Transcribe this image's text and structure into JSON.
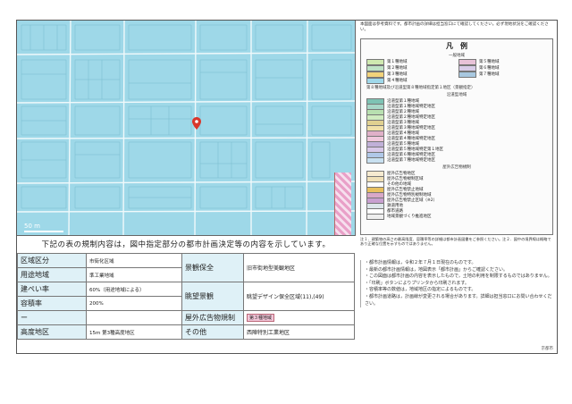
{
  "map": {
    "scale_label": "50 m",
    "pin_icon": "location-pin-icon"
  },
  "notes_top": "本図面は参考資料です。都市計画の詳細は担当窓口にて確認してください。必ず現地状況をご確認ください。",
  "legend": {
    "title": "凡　例",
    "section_zoning": "一般地域",
    "zoning_items": [
      {
        "label": "第１種地域",
        "color": "#cfe9b0"
      },
      {
        "label": "第５種地域",
        "color": "#e8c2d8"
      },
      {
        "label": "第２種地域",
        "color": "#bfe3c6"
      },
      {
        "label": "第６種地域",
        "color": "#d8cce8"
      },
      {
        "label": "第３種地域",
        "color": "#f2d37a"
      },
      {
        "label": "第７種地域",
        "color": "#a8c8e0"
      },
      {
        "label": "第４種地域",
        "color": "#9fd8ea"
      }
    ],
    "zoning_note": "第８種地域及び沿道型第８種地域指定第１地区（景観指定）",
    "section_roadside": "沿道型地域",
    "roadside_items": [
      {
        "label": "沿道型第１種地域",
        "color": "#7ec3b4"
      },
      {
        "label": "沿道型第１種地域特定地区",
        "color": "#a8d8c8"
      },
      {
        "label": "沿道型第２種地域",
        "color": "#b8e0b0"
      },
      {
        "label": "沿道型第２種地域特定地区",
        "color": "#d0ecc0"
      },
      {
        "label": "沿道型第３種地域",
        "color": "#e0d090"
      },
      {
        "label": "沿道型第３種地域特定地区",
        "color": "#f0e0a8"
      },
      {
        "label": "沿道型第４種地域",
        "color": "#e0b0c8"
      },
      {
        "label": "沿道型第４種地域特定地区",
        "color": "#f0c8dc"
      },
      {
        "label": "沿道型第５種地域",
        "color": "#c0b0d8"
      },
      {
        "label": "沿道型第５種地域特定第１地区",
        "color": "#d8c8e8"
      },
      {
        "label": "沿道型第６種地域特定地区",
        "color": "#b0c8e8"
      },
      {
        "label": "沿道型第７種地域特定地区",
        "color": "#c8e0f0"
      }
    ],
    "section_district": "屋外広告物規制",
    "district_items": [
      {
        "label": "屋外広告物地区",
        "color": "#f6ead0"
      },
      {
        "label": "屋外広告物規制区域",
        "color": "#f0e0b8"
      },
      {
        "label": "その他の地域",
        "color": "#ffffff"
      },
      {
        "label": "屋外広告物禁止地域",
        "color": "#e8c060"
      },
      {
        "label": "屋外広告物特別規制地域",
        "color": "#d8a8c8"
      },
      {
        "label": "屋外広告物禁止区域（※2）",
        "color": "#c8a0d0"
      },
      {
        "label": "鉄道用地",
        "color": "#dde6ea"
      },
      {
        "label": "都市道路",
        "color": "#ffffff"
      },
      {
        "label": "地域景観づくり推進地区",
        "color": "#eeeeee"
      }
    ]
  },
  "notes_mid": "注１．建築物の高さの最高限度、容積率等の詳細は都市計画図書をご参照ください。注２．図中の境界線は概略であり正確な位置を示すものではありません。",
  "caption": "下記の表の規制内容は，図中指定部分の都市計画決定等の内容を示しています。",
  "table": {
    "row1": {
      "l": "区域区分",
      "v": "市街化区域",
      "l2": "景観保全",
      "v2": "旧市街地型美観地区"
    },
    "row2": {
      "l": "用途地域",
      "v": "準工業地域",
      "l2": "",
      "v2": ""
    },
    "row3": {
      "l": "建ぺい率",
      "v": "60%（用途地域による）",
      "l2": "眺望景観",
      "v2": "眺望デザイン保全区域(11),(49)"
    },
    "row4": {
      "l": "容積率",
      "v": "200%",
      "l2": "",
      "v2": ""
    },
    "row5": {
      "l": "ー",
      "v": "",
      "l2": "屋外広告物規制",
      "v2": "第３種地域"
    },
    "row6": {
      "l": "高度地区",
      "v": "15m 第3種高度地区",
      "l2": "その他",
      "v2": "西陣特別工業地区"
    }
  },
  "notes_right": [
    "・都市計画情報は，令和２年７月１日現在のものです。",
    "・最新の都市計画情報は，地図表示「都市計画」からご確認ください。",
    "・この図面は都市計画の内容を表示したもので，土地の利用を制限するものではありません。",
    "・「印刷」ボタンによりプリンタから印刷されます。",
    "・容積率等の数値は，地域地区の指定によるものです。",
    "・都市計画道路は，計画線が変更される場合があります。詳細は担当窓口にお問い合わせください。"
  ],
  "footer": "京都市"
}
